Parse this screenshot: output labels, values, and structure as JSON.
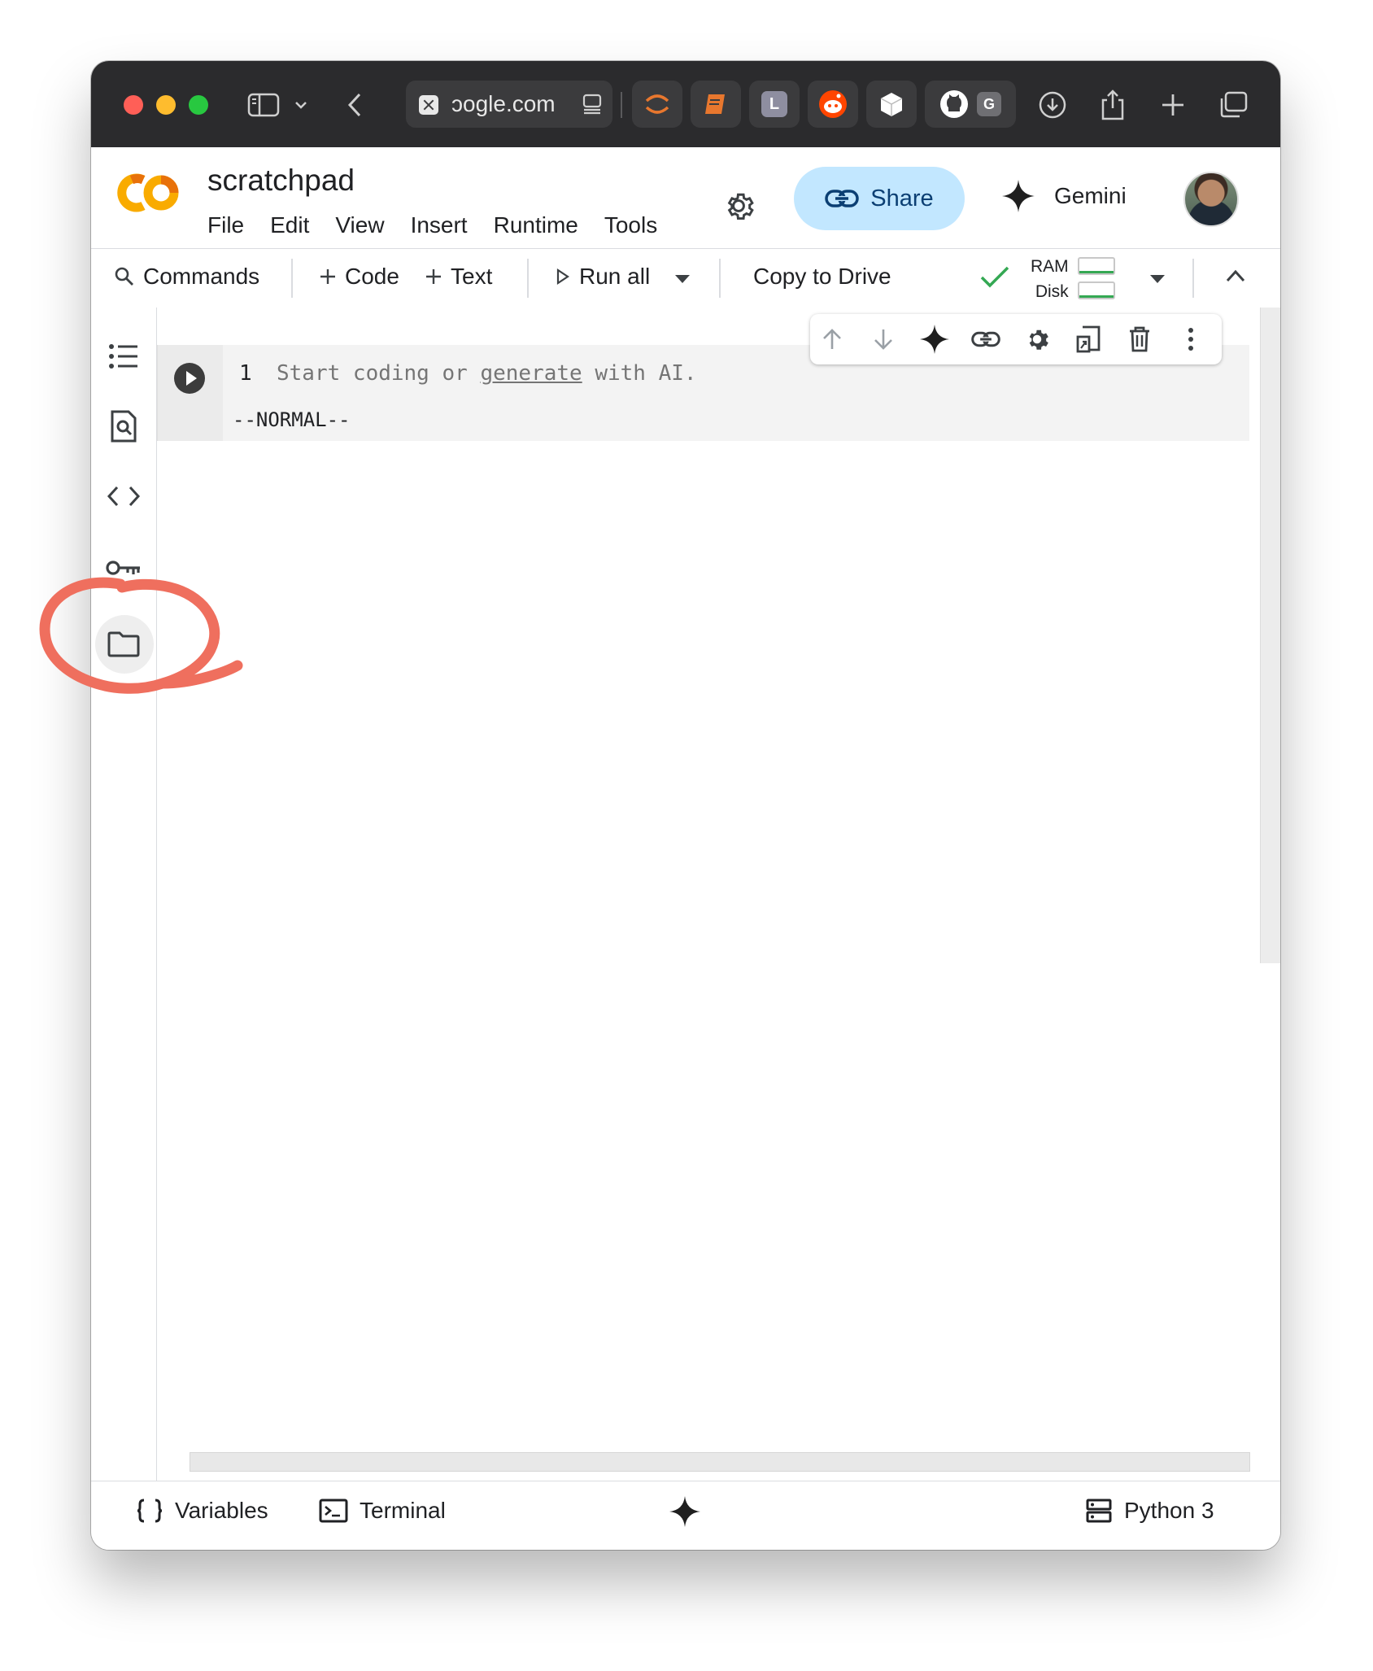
{
  "browser": {
    "url_text": "ɔogle.com",
    "tabs": [
      {
        "icon": "orange-arc-icon",
        "color": "#e8772e"
      },
      {
        "icon": "book-icon",
        "color": "#e8772e"
      },
      {
        "icon": "letter-l-icon",
        "letter": "L",
        "color": "#8e8ea0"
      },
      {
        "icon": "reddit-icon",
        "color": "#ff4500"
      },
      {
        "icon": "cube-icon",
        "color": "#ffffff"
      },
      {
        "icon": "github-icon",
        "color": "#ffffff"
      },
      {
        "icon": "letter-g-icon",
        "letter": "G",
        "color": "#6f6f73"
      }
    ]
  },
  "header": {
    "notebook_title": "scratchpad",
    "menu": [
      "File",
      "Edit",
      "View",
      "Insert",
      "Runtime",
      "Tools"
    ],
    "share_label": "Share",
    "gemini_label": "Gemini"
  },
  "toolbar": {
    "commands_label": "Commands",
    "code_label": "Code",
    "text_label": "Text",
    "run_all_label": "Run all",
    "copy_to_drive_label": "Copy to Drive",
    "ram_label": "RAM",
    "disk_label": "Disk",
    "connected_color": "#34a853"
  },
  "sidebar": {
    "items": [
      {
        "name": "table-of-contents",
        "icon": "list-icon"
      },
      {
        "name": "find-replace",
        "icon": "search-document-icon"
      },
      {
        "name": "code-snippets",
        "icon": "code-icon"
      },
      {
        "name": "secrets",
        "icon": "key-icon"
      },
      {
        "name": "files",
        "icon": "folder-icon",
        "selected": true
      }
    ]
  },
  "cell": {
    "line_number": "1",
    "placeholder_pre": "Start coding or ",
    "placeholder_link": "generate",
    "placeholder_post": " with AI.",
    "vim_mode": "--NORMAL--",
    "tools": [
      "arrow-up-icon",
      "arrow-down-icon",
      "sparkle-icon",
      "link-icon",
      "gear-icon",
      "mirror-cell-icon",
      "trash-icon",
      "more-vert-icon"
    ]
  },
  "statusbar": {
    "variables_label": "Variables",
    "terminal_label": "Terminal",
    "runtime_label": "Python 3"
  },
  "annotation": {
    "color": "#ef6f5e",
    "target": "files"
  }
}
